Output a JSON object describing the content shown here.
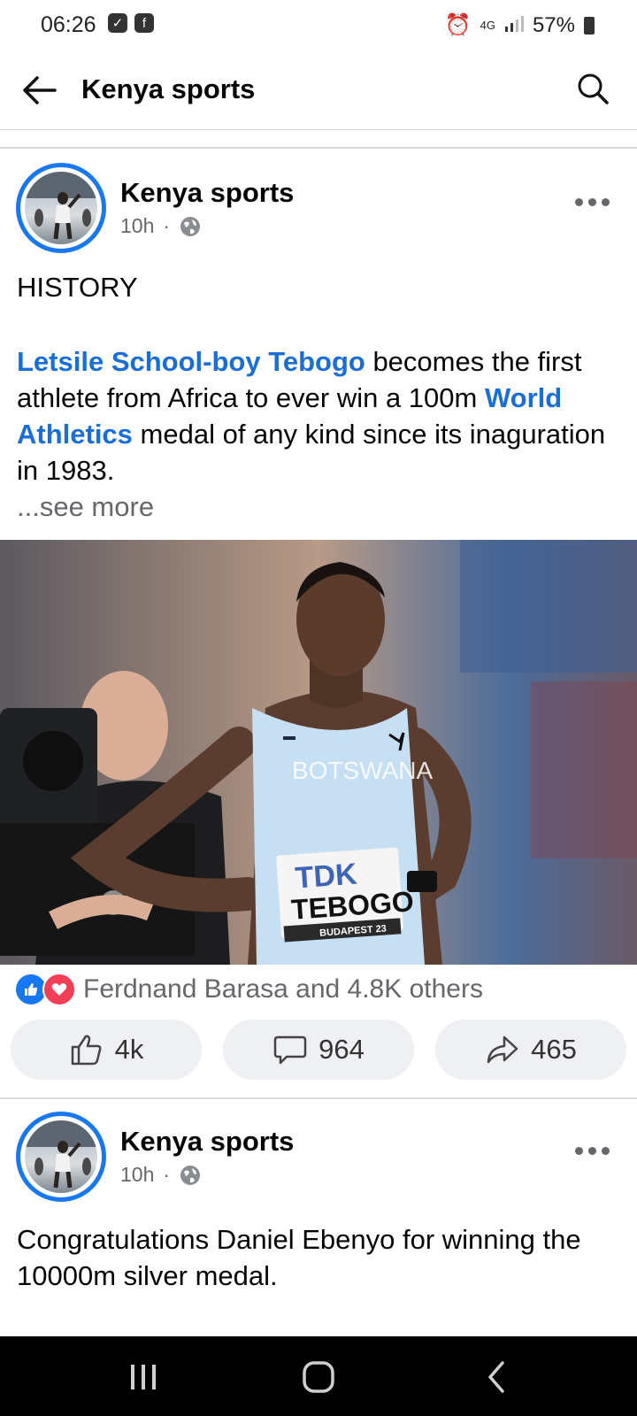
{
  "status_bar": {
    "time": "06:26",
    "network": "4G",
    "battery": "57%"
  },
  "header": {
    "title": "Kenya sports"
  },
  "posts": [
    {
      "author": "Kenya sports",
      "time": "10h",
      "separator": "·",
      "heading": "HISTORY",
      "body_link1": "Letsile School-boy Tebogo",
      "body_text1": " becomes the first athlete from Africa to ever win a 100m ",
      "body_link2": "World Athletics",
      "body_text2": " medal of any kind since its inaguration in 1983.",
      "see_more": "...see more",
      "image": {
        "jersey_text": "BOTSWANA",
        "bib_brand": "TDK",
        "bib_name": "TEBOGO",
        "bib_event": "BUDAPEST 23"
      },
      "reactions_text": "Ferdnand Barasa and 4.8K others",
      "likes": "4k",
      "comments": "964",
      "shares": "465"
    },
    {
      "author": "Kenya sports",
      "time": "10h",
      "separator": "·",
      "body": "Congratulations Daniel Ebenyo for winning the 10000m silver medal."
    }
  ],
  "colors": {
    "accent": "#1877f2",
    "link": "#1a6ed8",
    "secondary_text": "#65676b",
    "love": "#f33e58"
  }
}
